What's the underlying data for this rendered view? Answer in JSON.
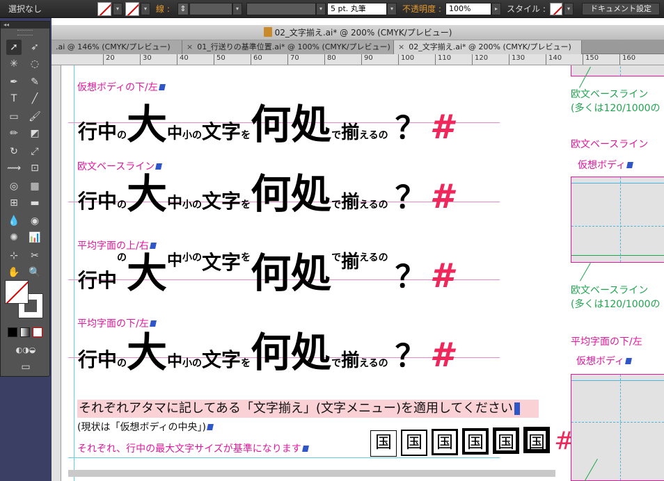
{
  "control_bar": {
    "selection": "選択なし",
    "stroke_label": "線 :",
    "brush_value": "5 pt. 丸筆",
    "opacity_label": "不透明度 :",
    "opacity_value": "100%",
    "style_label": "スタイル :",
    "doc_setup_button": "ドキュメント設定"
  },
  "document_title": "02_文字揃え.ai* @ 200% (CMYK/プレビュー)",
  "tabs": [
    {
      "label": ".ai @ 146% (CMYK/プレビュー)",
      "close": "×"
    },
    {
      "label": "01_行送りの基準位置.ai* @ 100% (CMYK/プレビュー)",
      "close": "×"
    },
    {
      "label": "02_文字揃え.ai* @ 200% (CMYK/プレビュー)",
      "close": "×",
      "active": true
    }
  ],
  "ruler_labels": [
    "20",
    "30",
    "40",
    "50",
    "60",
    "70",
    "80",
    "90",
    "100",
    "110",
    "120",
    "130",
    "140",
    "150",
    "160"
  ],
  "toolbox": {
    "collapse": "◂◂"
  },
  "sections": [
    {
      "label": "仮想ボディの下/左"
    },
    {
      "label": "欧文ベースライン"
    },
    {
      "label": "平均字面の上/右"
    },
    {
      "label": "平均字面の下/左"
    }
  ],
  "sample_text": {
    "t1": "行中",
    "t2": "の",
    "t3": "大",
    "t4": "中",
    "t5": "小の",
    "t6": "文字",
    "t7": "を",
    "t8": "何処",
    "t9": "で",
    "t10": "揃",
    "t11": "えるの",
    "t12": "？",
    "t13": "#"
  },
  "notes": {
    "n1": "それぞれアタマに記してある「文字揃え」(文字メニュー)を適用してください",
    "n2": "(現状は「仮想ボディの中央」)",
    "n3": "それぞれ、行中の最大文字サイズが基準になります"
  },
  "kanji_samples": [
    "国",
    "国",
    "国",
    "国",
    "国",
    "国"
  ],
  "kanji_hash": "#",
  "right_labels": {
    "r1": "欧文ベースライン",
    "r1b": "(多くは120/1000の",
    "r2": "欧文ベースライン",
    "r3": "仮想ボディ",
    "r4": "欧文ベースライン",
    "r4b": "(多くは120/1000の",
    "r5": "平均字面の下/左",
    "r6": "仮想ボディ"
  },
  "colors": {
    "magenta": "#e0179b",
    "green": "#1fa44f",
    "pink_hash": "#f0275b"
  }
}
